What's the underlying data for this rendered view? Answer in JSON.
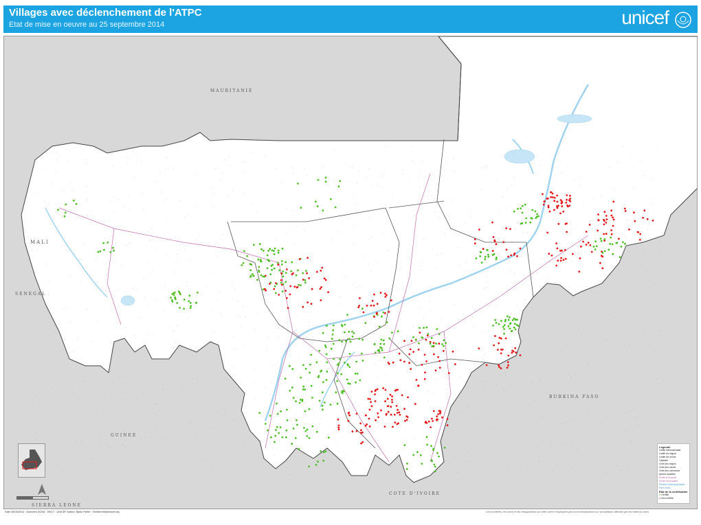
{
  "header": {
    "title": "Villages avec déclenchement de l'ATPC",
    "subtitle": "Etat de mise en oeuvre au 25 septembre 2014",
    "logo_text": "unicef",
    "background_color": "#1ca4e2"
  },
  "map": {
    "country_labels": {
      "mauritanie": "MAURITANIE",
      "mali": "MALI",
      "senegal": "SENEGAL",
      "guinee": "GUINEE",
      "burkina": "BURKINA FASO",
      "cote_divoire": "COTE D'IVOIRE",
      "sierra_leone": "SIERRA LEONE"
    },
    "colors": {
      "certified": "#4fbf26",
      "not_certified": "#e41a1c",
      "water": "#c6e6f7",
      "land": "#ffffff",
      "neighbors": "#d8d8d8",
      "roads": "#c06bb0"
    }
  },
  "legend": {
    "title": "Légende",
    "items": [
      "Limite internationale",
      "Limite de région",
      "Limite de cercle",
      "Capitale",
      "Chef-lieu région",
      "Chef-lieu cercle",
      "Chef-lieu commune",
      "Autres localités",
      "Route principale",
      "Route secondaire",
      "Réseau hydrographique",
      "Plan d'eau"
    ],
    "status_title": "Etat de la certification",
    "status_items": [
      "Certifié",
      "Non certifié"
    ]
  },
  "footer": {
    "left": "Date 25/09/2014 · Données DCNA · DNCT · UNICEF   Auteur: Bassi Pathé · ©infoferme@unicef.org",
    "right": "Les frontières, les noms et les désignations sur cette carte n'impliquent pas la reconnaissance ou l'acceptation officielle par les Nations Unies"
  }
}
